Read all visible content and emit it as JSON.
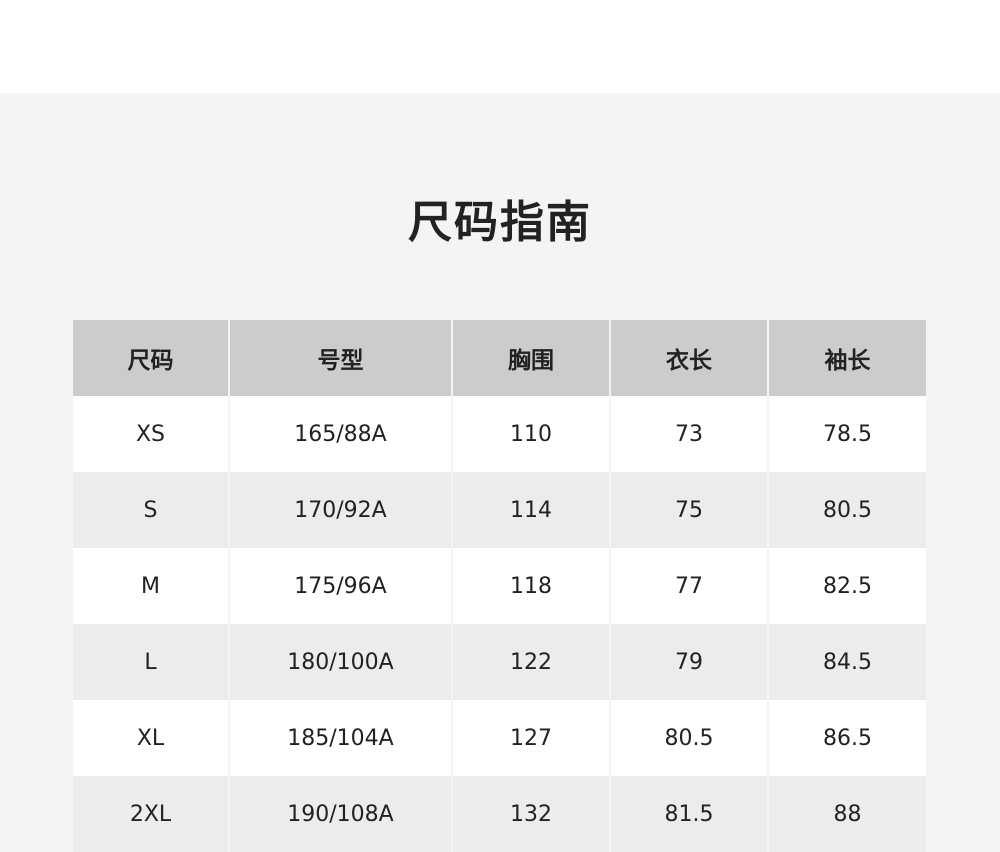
{
  "page": {
    "title": "尺码指南"
  },
  "colors": {
    "panel_background": "#f4f4f4",
    "header_background": "#cccccc",
    "row_odd": "#ffffff",
    "row_even": "#ececec",
    "text": "#222222"
  },
  "table": {
    "headers": [
      "尺码",
      "号型",
      "胸围",
      "衣长",
      "袖长"
    ],
    "rows": [
      [
        "XS",
        "165/88A",
        "110",
        "73",
        "78.5"
      ],
      [
        "S",
        "170/92A",
        "114",
        "75",
        "80.5"
      ],
      [
        "M",
        "175/96A",
        "118",
        "77",
        "82.5"
      ],
      [
        "L",
        "180/100A",
        "122",
        "79",
        "84.5"
      ],
      [
        "XL",
        "185/104A",
        "127",
        "80.5",
        "86.5"
      ],
      [
        "2XL",
        "190/108A",
        "132",
        "81.5",
        "88"
      ]
    ]
  }
}
